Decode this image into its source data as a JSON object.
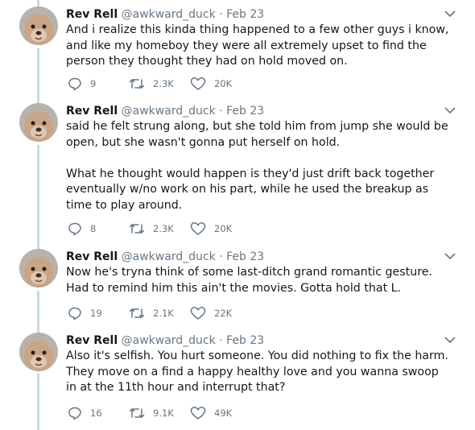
{
  "tweets": [
    {
      "name": "Rev Rell",
      "handle": "@awkward_duck",
      "separator": "·",
      "date": "Feb 23",
      "paragraphs": [
        "And i realize this kinda thing happened to a few other guys i know, and like my homeboy they were all extremely upset to find the person they thought they had on hold moved on."
      ],
      "replies": "9",
      "retweets": "2.3K",
      "likes": "20K"
    },
    {
      "name": "Rev Rell",
      "handle": "@awkward_duck",
      "separator": "·",
      "date": "Feb 23",
      "paragraphs": [
        "said he felt strung along, but she told him from jump she would be open, but she wasn't gonna put herself on hold.",
        "What he thought would happen is they'd just drift back together eventually w/no work on his part, while he used the breakup as time to play around."
      ],
      "replies": "8",
      "retweets": "2.3K",
      "likes": "20K"
    },
    {
      "name": "Rev Rell",
      "handle": "@awkward_duck",
      "separator": "·",
      "date": "Feb 23",
      "paragraphs": [
        "Now he's tryna think of some last-ditch grand romantic gesture. Had to remind him this ain't the movies. Gotta hold that L."
      ],
      "replies": "19",
      "retweets": "2.1K",
      "likes": "22K"
    },
    {
      "name": "Rev Rell",
      "handle": "@awkward_duck",
      "separator": "·",
      "date": "Feb 23",
      "paragraphs": [
        "Also it's selfish. You hurt someone. You did nothing to fix the harm. They move on a find a happy healthy love and you wanna swoop in at the 11th hour and interrupt that?"
      ],
      "replies": "16",
      "retweets": "9.1K",
      "likes": "49K"
    }
  ],
  "icons": {
    "reply": "reply-icon",
    "retweet": "retweet-icon",
    "like": "heart-icon",
    "menu": "chevron-down-icon",
    "avatar": "dog-avatar"
  },
  "colors": {
    "thread_line": "#c4dbe6",
    "secondary_text": "#657786",
    "primary_text": "#14171a"
  }
}
